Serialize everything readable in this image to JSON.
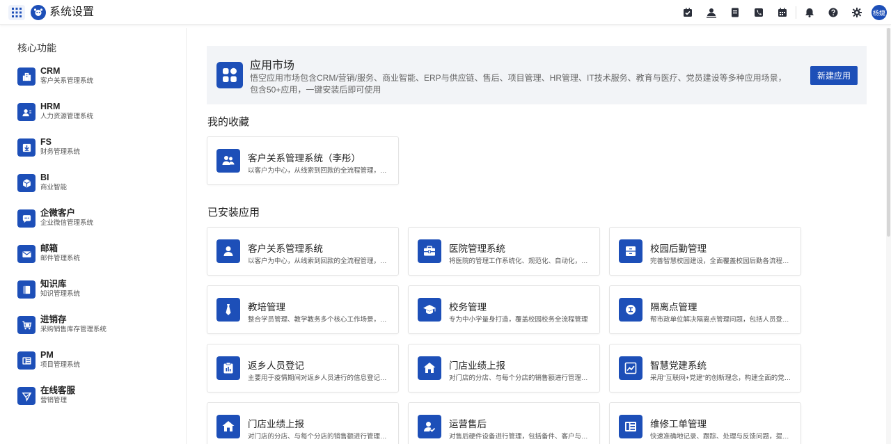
{
  "header": {
    "title": "系统设置",
    "avatar_text": "杨婕",
    "icons": [
      "task-icon",
      "contacts-icon",
      "document-icon",
      "phone-icon",
      "calendar-icon",
      "bell-icon",
      "help-icon",
      "settings-icon"
    ]
  },
  "sidebar": {
    "title": "核心功能",
    "items": [
      {
        "name": "CRM",
        "sub": "客户关系管理系统",
        "icon": "building-icon"
      },
      {
        "name": "HRM",
        "sub": "人力资源管理系统",
        "icon": "user-card-icon"
      },
      {
        "name": "FS",
        "sub": "财务管理系统",
        "icon": "download-icon"
      },
      {
        "name": "BI",
        "sub": "商业智能",
        "icon": "cube-icon"
      },
      {
        "name": "企微客户",
        "sub": "企业微信管理系统",
        "icon": "chat-icon"
      },
      {
        "name": "邮箱",
        "sub": "邮件管理系统",
        "icon": "mail-icon"
      },
      {
        "name": "知识库",
        "sub": "知识管理系统",
        "icon": "book-icon"
      },
      {
        "name": "进销存",
        "sub": "采购销售库存管理系统",
        "icon": "cart-icon"
      },
      {
        "name": "PM",
        "sub": "项目管理系统",
        "icon": "board-icon"
      },
      {
        "name": "在线客服",
        "sub": "营销管理",
        "icon": "send-icon"
      }
    ]
  },
  "market": {
    "title": "应用市场",
    "desc_line1": "悟空应用市场包含CRM/营销/服务、商业智能、ERP与供应链、售后、项目管理、HR管理、IT技术服务、教育与医疗、党员建设等多种应用场景，",
    "desc_line2": "包含50+应用，一键安装后即可使用",
    "button": "新建应用"
  },
  "favorites": {
    "title": "我的收藏",
    "items": [
      {
        "name": "客户关系管理系统（李彤）",
        "desc": "以客户为中心，从线索到回款的全流程管理，助力企业实现高效增长",
        "icon": "users-icon"
      }
    ]
  },
  "installed": {
    "title": "已安装应用",
    "items": [
      {
        "name": "客户关系管理系统",
        "desc": "以客户为中心，从线索到回款的全流程管理，助力企业实现高效增长",
        "icon": "user-icon"
      },
      {
        "name": "医院管理系统",
        "desc": "将医院的管理工作系统化、规范化、自动化，提高医院管理效率",
        "icon": "medkit-icon"
      },
      {
        "name": "校园后勤管理",
        "desc": "完善智慧校园建设，全面覆盖校园后勤各流程管理",
        "icon": "cabinet-icon"
      },
      {
        "name": "教培管理",
        "desc": "整合学员管理、教学教务多个核心工作场景，提升机构管理效率",
        "icon": "tie-icon"
      },
      {
        "name": "校务管理",
        "desc": "专为中小学量身打造，覆盖校园校务全流程管理",
        "icon": "graduation-cap-icon"
      },
      {
        "name": "隔离点管理",
        "desc": "帮市政单位解决隔离点管理问题，包括人员登记与物资管理",
        "icon": "badge-icon"
      },
      {
        "name": "返乡人员登记",
        "desc": "主要用于疫情期间对返乡人员进行的信息登记与统计",
        "icon": "clipboard-icon"
      },
      {
        "name": "门店业绩上报",
        "desc": "对门店的分店、与每个分店的销售额进行管理与统计",
        "icon": "store-icon"
      },
      {
        "name": "智慧党建系统",
        "desc": "采用\"互联网+党建\"的创新理念，构建全面的党建工作平台",
        "icon": "trend-icon"
      },
      {
        "name": "门店业绩上报",
        "desc": "对门店的分店、与每个分店的销售额进行管理与统计",
        "icon": "store-icon"
      },
      {
        "name": "运营售后",
        "desc": "对售后硬件设备进行管理，包括备件、客户与工单",
        "icon": "user-check-icon"
      },
      {
        "name": "维修工单管理",
        "desc": "快速准确地记录、跟踪、处理与反馈问题，提升服务效率",
        "icon": "board-icon"
      }
    ]
  }
}
